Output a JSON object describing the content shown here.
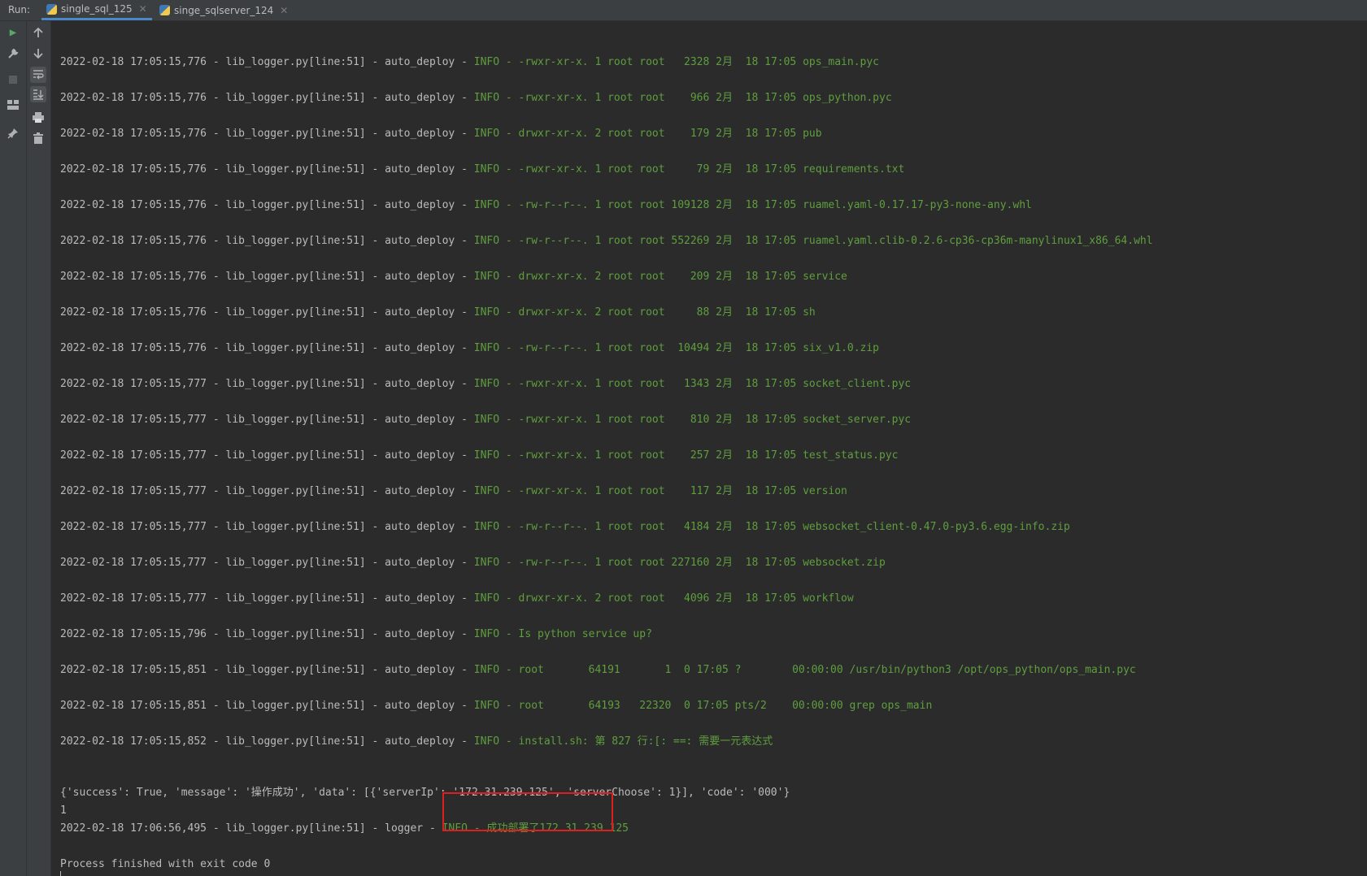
{
  "run_bar": {
    "label": "Run:",
    "tabs": [
      {
        "label": "single_sql_125",
        "active": true
      },
      {
        "label": "singe_sqlserver_124",
        "active": false
      }
    ]
  },
  "toolbar_left": [
    "run-icon",
    "wrench-icon",
    "stop-icon",
    "layout-icon",
    "pin-icon"
  ],
  "toolbar_right": [
    "arrow-up-icon",
    "arrow-down-icon",
    "soft-wrap-icon",
    "scroll-to-end-icon",
    "print-icon",
    "trash-icon"
  ],
  "log_prefix": " - lib_logger.py[line:51] - auto_deploy - ",
  "log_lines": [
    {
      "ts": "2022-02-18 17:05:15,776",
      "msg": "INFO - -rwxr-xr-x. 1 root root   2328 2月  18 17:05 ops_main.pyc"
    },
    {
      "ts": "2022-02-18 17:05:15,776",
      "msg": "INFO - -rwxr-xr-x. 1 root root    966 2月  18 17:05 ops_python.pyc"
    },
    {
      "ts": "2022-02-18 17:05:15,776",
      "msg": "INFO - drwxr-xr-x. 2 root root    179 2月  18 17:05 pub"
    },
    {
      "ts": "2022-02-18 17:05:15,776",
      "msg": "INFO - -rwxr-xr-x. 1 root root     79 2月  18 17:05 requirements.txt"
    },
    {
      "ts": "2022-02-18 17:05:15,776",
      "msg": "INFO - -rw-r--r--. 1 root root 109128 2月  18 17:05 ruamel.yaml-0.17.17-py3-none-any.whl"
    },
    {
      "ts": "2022-02-18 17:05:15,776",
      "msg": "INFO - -rw-r--r--. 1 root root 552269 2月  18 17:05 ruamel.yaml.clib-0.2.6-cp36-cp36m-manylinux1_x86_64.whl"
    },
    {
      "ts": "2022-02-18 17:05:15,776",
      "msg": "INFO - drwxr-xr-x. 2 root root    209 2月  18 17:05 service"
    },
    {
      "ts": "2022-02-18 17:05:15,776",
      "msg": "INFO - drwxr-xr-x. 2 root root     88 2月  18 17:05 sh"
    },
    {
      "ts": "2022-02-18 17:05:15,776",
      "msg": "INFO - -rw-r--r--. 1 root root  10494 2月  18 17:05 six_v1.0.zip"
    },
    {
      "ts": "2022-02-18 17:05:15,777",
      "msg": "INFO - -rwxr-xr-x. 1 root root   1343 2月  18 17:05 socket_client.pyc"
    },
    {
      "ts": "2022-02-18 17:05:15,777",
      "msg": "INFO - -rwxr-xr-x. 1 root root    810 2月  18 17:05 socket_server.pyc"
    },
    {
      "ts": "2022-02-18 17:05:15,777",
      "msg": "INFO - -rwxr-xr-x. 1 root root    257 2月  18 17:05 test_status.pyc"
    },
    {
      "ts": "2022-02-18 17:05:15,777",
      "msg": "INFO - -rwxr-xr-x. 1 root root    117 2月  18 17:05 version"
    },
    {
      "ts": "2022-02-18 17:05:15,777",
      "msg": "INFO - -rw-r--r--. 1 root root   4184 2月  18 17:05 websocket_client-0.47.0-py3.6.egg-info.zip"
    },
    {
      "ts": "2022-02-18 17:05:15,777",
      "msg": "INFO - -rw-r--r--. 1 root root 227160 2月  18 17:05 websocket.zip"
    },
    {
      "ts": "2022-02-18 17:05:15,777",
      "msg": "INFO - drwxr-xr-x. 2 root root   4096 2月  18 17:05 workflow"
    },
    {
      "ts": "2022-02-18 17:05:15,796",
      "msg": "INFO - Is python service up?"
    },
    {
      "ts": "2022-02-18 17:05:15,851",
      "msg": "INFO - root       64191       1  0 17:05 ?        00:00:00 /usr/bin/python3 /opt/ops_python/ops_main.pyc"
    },
    {
      "ts": "2022-02-18 17:05:15,851",
      "msg": "INFO - root       64193   22320  0 17:05 pts/2    00:00:00 grep ops_main"
    },
    {
      "ts": "2022-02-18 17:05:15,852",
      "msg": "INFO - install.sh: 第 827 行:[: ==: 需要一元表达式"
    }
  ],
  "result_dict": "{'success': True, 'message': '操作成功', 'data': [{'serverIp': '172.31.239.125', 'serverChoose': 1}], 'code': '000'}",
  "result_number": "1",
  "final_log": {
    "prefix": "2022-02-18 17:06:56,495 - lib_logger.py[line:51] - logger - ",
    "msg": "INFO - 成功部署了172.31.239.125"
  },
  "exit_message": "Process finished with exit code 0"
}
